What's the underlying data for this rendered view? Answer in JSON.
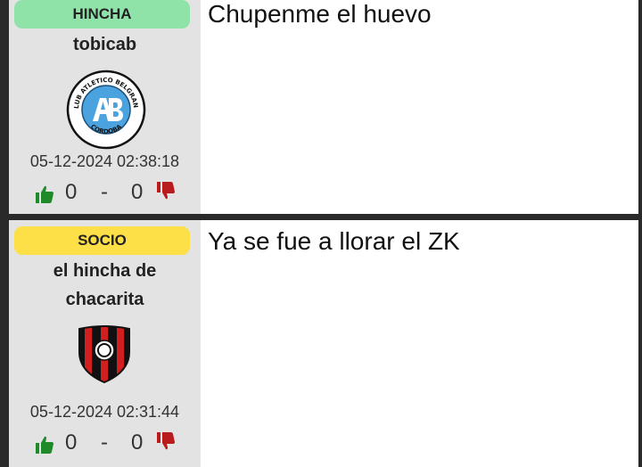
{
  "posts": [
    {
      "badge": "HINCHA",
      "username": "tobicab",
      "crest": "belgrano-crest",
      "crest_text_top": "CLUB ATLETICO BELGRANO",
      "crest_text_bottom": "CORDOBA",
      "date": "05-12-2024 02:38:18",
      "likes": "0",
      "sep": "-",
      "dislikes": "0",
      "message": "Chupenme el huevo"
    },
    {
      "badge": "SOCIO",
      "username": "el hincha de chacarita",
      "crest": "chacarita-crest",
      "date": "05-12-2024 02:31:44",
      "likes": "0",
      "sep": "-",
      "dislikes": "0",
      "message": "Ya se fue a llorar el ZK"
    }
  ],
  "colors": {
    "hincha_badge": "#8fe3a8",
    "socio_badge": "#fde047",
    "thumbs_up": "#1f8a2a",
    "thumbs_down": "#b91c1c",
    "belgrano_blue": "#4aa3df"
  }
}
